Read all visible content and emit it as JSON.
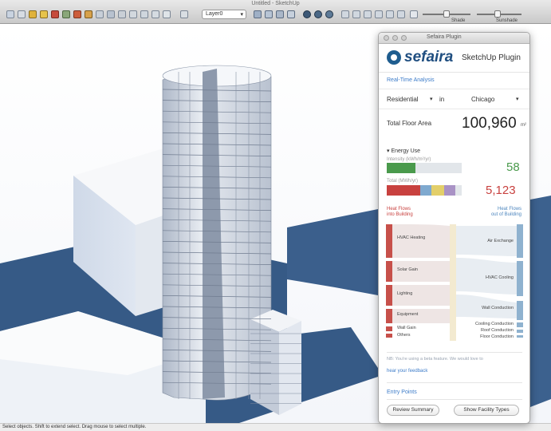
{
  "window": {
    "title": "Untitled - SketchUp"
  },
  "toolbar": {
    "layer_value": "Layer0",
    "slider_labels": [
      "Shade",
      "Sunshade"
    ]
  },
  "status": {
    "text": "Select objects. Shift to extend select. Drag mouse to select multiple."
  },
  "panel": {
    "title": "Sefaira Plugin",
    "brand": "sefaira",
    "brand_sub": "SketchUp Plugin",
    "realtime_label": "Real-Time Analysis",
    "building_type": "Residential",
    "in_label": "in",
    "location": "Chicago",
    "total_floor_area_label": "Total Floor Area",
    "total_floor_area_value": "100,960",
    "total_floor_area_unit": "m²",
    "energy_use_label": "Energy Use",
    "intensity_label": "Intensity (kWh/m²/yr)",
    "intensity_value": "58",
    "intensity_fill": 0.38,
    "total_label": "Total (MWh/yr)",
    "total_value": "5,123",
    "heat_in_label_1": "Heat Flows",
    "heat_in_label_2": "into Building",
    "heat_out_label_1": "Heat Flows",
    "heat_out_label_2": "out of Building",
    "flow_left": [
      "HVAC Heating",
      "Solar Gain",
      "Lighting",
      "Equipment",
      "Wall Gain",
      "Others"
    ],
    "flow_right": [
      "Air Exchange",
      "HVAC Cooling",
      "Wall Conduction",
      "Cooling Conduction",
      "Roof Conduction",
      "Floor Conduction"
    ],
    "footnote": "NB: You're using a beta feature. We would love to",
    "feedback_link": "hear your feedback",
    "entry_points_label": "Entry Points",
    "btn_review": "Review Summary",
    "btn_geometry": "Show Facility Types"
  },
  "colors": {
    "brand": "#1f4e80",
    "link": "#3d7cc9",
    "intensity_green": "#4a9a4c",
    "total_red": "#c8413f",
    "heat_in": "#c7504a",
    "heat_out": "#8fb2cf",
    "shadow": "#365a86"
  }
}
